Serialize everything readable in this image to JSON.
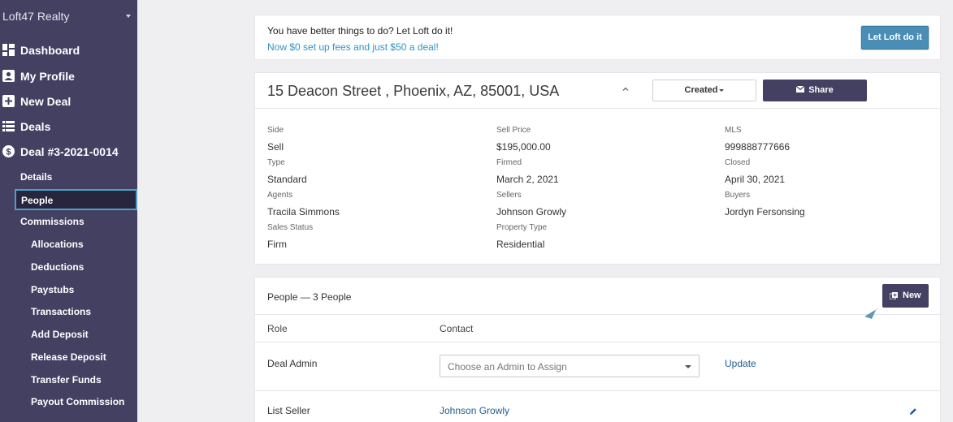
{
  "sidebar": {
    "brand": "Loft47 Realty",
    "top_items": [
      {
        "label": "Dashboard",
        "icon": "dashboard-icon"
      },
      {
        "label": "My Profile",
        "icon": "profile-icon"
      },
      {
        "label": "New Deal",
        "icon": "plus-square-icon"
      },
      {
        "label": "Deals",
        "icon": "list-icon"
      },
      {
        "label": "Deal #3-2021-0014",
        "icon": "dollar-circle-icon"
      }
    ],
    "sub_items": [
      {
        "label": "Details"
      },
      {
        "label": "People",
        "active": true
      },
      {
        "label": "Commissions"
      },
      {
        "label": "Allocations"
      },
      {
        "label": "Deductions"
      },
      {
        "label": "Paystubs"
      },
      {
        "label": "Transactions"
      },
      {
        "label": "Add Deposit"
      },
      {
        "label": "Release Deposit"
      },
      {
        "label": "Transfer Funds"
      },
      {
        "label": "Payout Commission"
      }
    ]
  },
  "promo": {
    "title": "You have better things to do? Let Loft do it!",
    "subtitle": "Now $0 set up fees and just $50 a deal!",
    "button": "Let Loft do it"
  },
  "deal": {
    "address": "15 Deacon Street , Phoenix, AZ, 85001, USA",
    "status_button": "Created",
    "share_button": "Share",
    "fields": {
      "side": {
        "label": "Side",
        "value": "Sell"
      },
      "type": {
        "label": "Type",
        "value": "Standard"
      },
      "agents": {
        "label": "Agents",
        "value": "Tracila Simmons"
      },
      "sales_status": {
        "label": "Sales Status",
        "value": "Firm"
      },
      "sell_price": {
        "label": "Sell Price",
        "value": "$195,000.00"
      },
      "firmed": {
        "label": "Firmed",
        "value": "March 2, 2021"
      },
      "sellers": {
        "label": "Sellers",
        "value": "Johnson Growly"
      },
      "property_type": {
        "label": "Property Type",
        "value": "Residential"
      },
      "mls": {
        "label": "MLS",
        "value": "999888777666"
      },
      "closed": {
        "label": "Closed",
        "value": "April 30, 2021"
      },
      "buyers": {
        "label": "Buyers",
        "value": "Jordyn Fersonsing"
      }
    }
  },
  "people": {
    "title": "People — 3 People",
    "new_button": "New",
    "columns": {
      "role": "Role",
      "contact": "Contact"
    },
    "rows": [
      {
        "role": "Deal Admin",
        "select_placeholder": "Choose an Admin to Assign",
        "action": "Update"
      },
      {
        "role": "List Seller",
        "contact": "Johnson Growly"
      }
    ]
  },
  "colors": {
    "sidebar_bg": "#434062",
    "accent_blue": "#2c94c9",
    "link_blue": "#1f5d93",
    "button_dark": "#434062",
    "button_blue": "#4a8db5"
  }
}
